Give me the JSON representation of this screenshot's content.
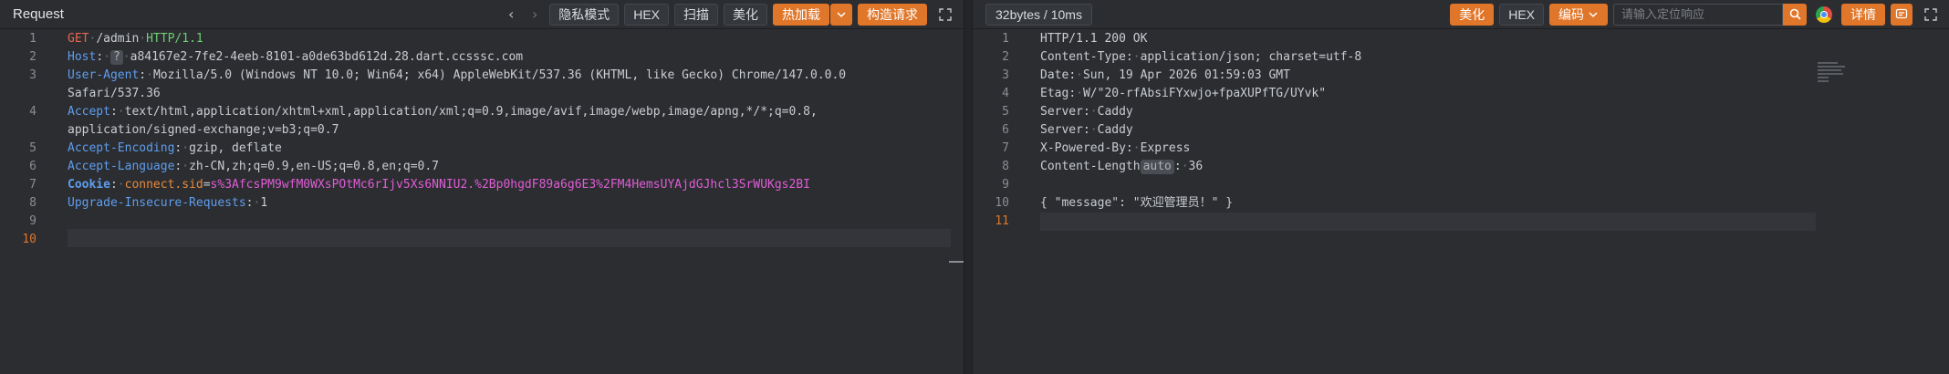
{
  "request": {
    "title": "Request",
    "buttons": {
      "privacy": "隐私模式",
      "hex": "HEX",
      "scan": "扫描",
      "beautify": "美化",
      "hot_load": "热加载",
      "build_request": "构造请求"
    },
    "lines": [
      {
        "n": "1"
      },
      {
        "n": "2",
        "host_label": "Host",
        "host_value": "a84167e2-7fe2-4eeb-8101-a0de63bd612d.28.dart.ccsssc.com"
      },
      {
        "n": "3",
        "label": "User-Agent",
        "value1": "Mozilla/5.0 (Windows NT 10.0; Win64; x64) AppleWebKit/537.36 (KHTML, like Gecko) Chrome/147.0.0.0",
        "value2": "Safari/537.36"
      },
      {
        "n": "4",
        "label": "Accept",
        "value1": "text/html,application/xhtml+xml,application/xml;q=0.9,image/avif,image/webp,image/apng,*/*;q=0.8,",
        "value2": "application/signed-exchange;v=b3;q=0.7"
      },
      {
        "n": "5",
        "label": "Accept-Encoding",
        "value": "gzip, deflate"
      },
      {
        "n": "6",
        "label": "Accept-Language",
        "value": "zh-CN,zh;q=0.9,en-US;q=0.8,en;q=0.7"
      },
      {
        "n": "7",
        "label": "Cookie",
        "cookie_name": "connect.sid",
        "cookie_value": "s%3AfcsPM9wfM0WXsPOtMc6rIjv5Xs6NNIU2.%2Bp0hgdF89a6g6E3%2FM4HemsUYAjdGJhcl3SrWUKgs2BI"
      },
      {
        "n": "8",
        "label": "Upgrade-Insecure-Requests",
        "value": "1"
      },
      {
        "n": "9"
      },
      {
        "n": "10"
      }
    ],
    "request_line": {
      "method": "GET",
      "path": "/admin",
      "protocol": "HTTP/1.1"
    }
  },
  "response": {
    "stats": "32bytes / 10ms",
    "buttons": {
      "beautify": "美化",
      "hex": "HEX",
      "encoding": "编码",
      "details": "详情"
    },
    "search": {
      "placeholder": "请输入定位响应"
    },
    "lines": [
      {
        "n": "1",
        "text": "HTTP/1.1 200 OK"
      },
      {
        "n": "2",
        "label": "Content-Type",
        "value": "application/json; charset=utf-8"
      },
      {
        "n": "3",
        "label": "Date",
        "value": "Sun, 19 Apr 2026 01:59:03 GMT"
      },
      {
        "n": "4",
        "label": "Etag",
        "value": "W/\"20-rfAbsiFYxwjo+fpaXUPfTG/UYvk\""
      },
      {
        "n": "5",
        "label": "Server",
        "value": "Caddy"
      },
      {
        "n": "6",
        "label": "Server",
        "value": "Caddy"
      },
      {
        "n": "7",
        "label": "X-Powered-By",
        "value": "Express"
      },
      {
        "n": "8",
        "label": "Content-Length",
        "chip": "auto",
        "value": "36"
      },
      {
        "n": "9"
      },
      {
        "n": "10",
        "text": "{ \"message\": \"欢迎管理员！\" }"
      },
      {
        "n": "11"
      }
    ]
  },
  "colors": {
    "accent": "#e0762a",
    "header_key": "#5f9ded",
    "method": "#e8674e",
    "protocol": "#6fcf74",
    "cookie_value": "#e05dd6"
  },
  "icons": [
    "chevron-left-icon",
    "chevron-right-icon",
    "dropdown-icon",
    "fullscreen-icon",
    "search-icon",
    "chrome-icon",
    "comment-icon"
  ]
}
